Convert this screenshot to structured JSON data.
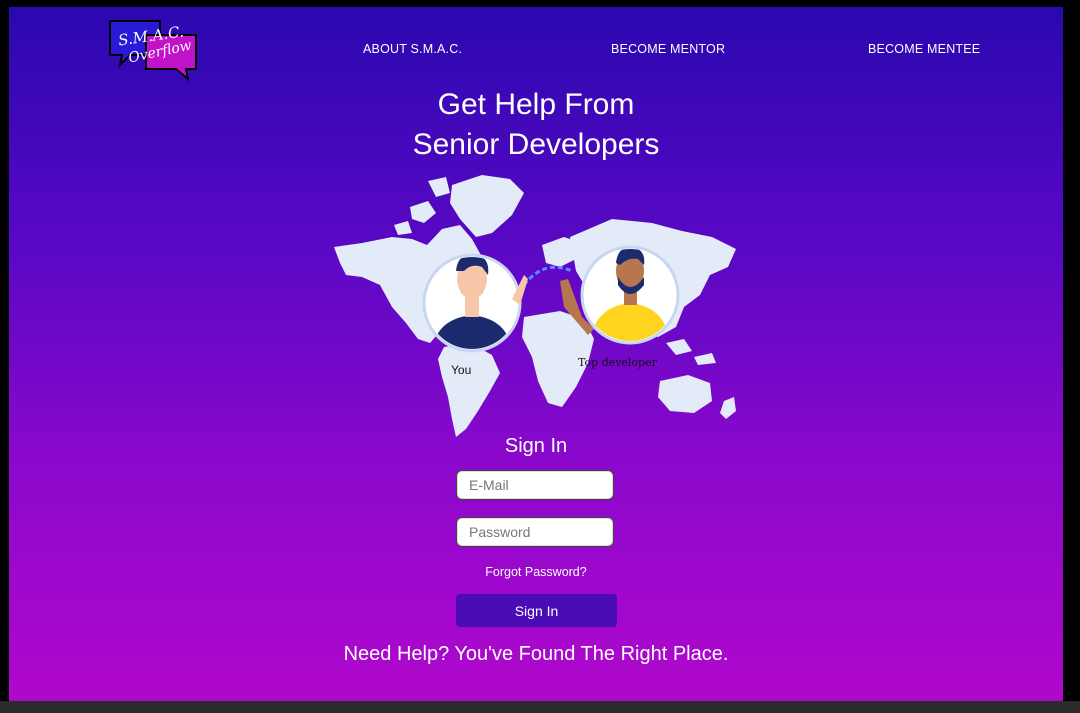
{
  "logo": {
    "line1": "S.M.A.C.",
    "line2": "Overflow"
  },
  "nav": {
    "items": [
      {
        "label": "ABOUT S.M.A.C."
      },
      {
        "label": "BECOME MENTOR"
      },
      {
        "label": "BECOME MENTEE"
      }
    ]
  },
  "hero": {
    "title_line1": "Get Help From",
    "title_line2": "Senior Developers",
    "label_you": "You",
    "label_top": "Top developer"
  },
  "signin": {
    "title": "Sign In",
    "email_placeholder": "E-Mail",
    "password_placeholder": "Password",
    "forgot": "Forgot Password?",
    "button": "Sign In"
  },
  "tagline": "Need Help? You've Found The Right Place.",
  "colors": {
    "gradient_top": "#2a08b0",
    "gradient_bottom": "#b008cc",
    "button": "#4a0cb4"
  }
}
